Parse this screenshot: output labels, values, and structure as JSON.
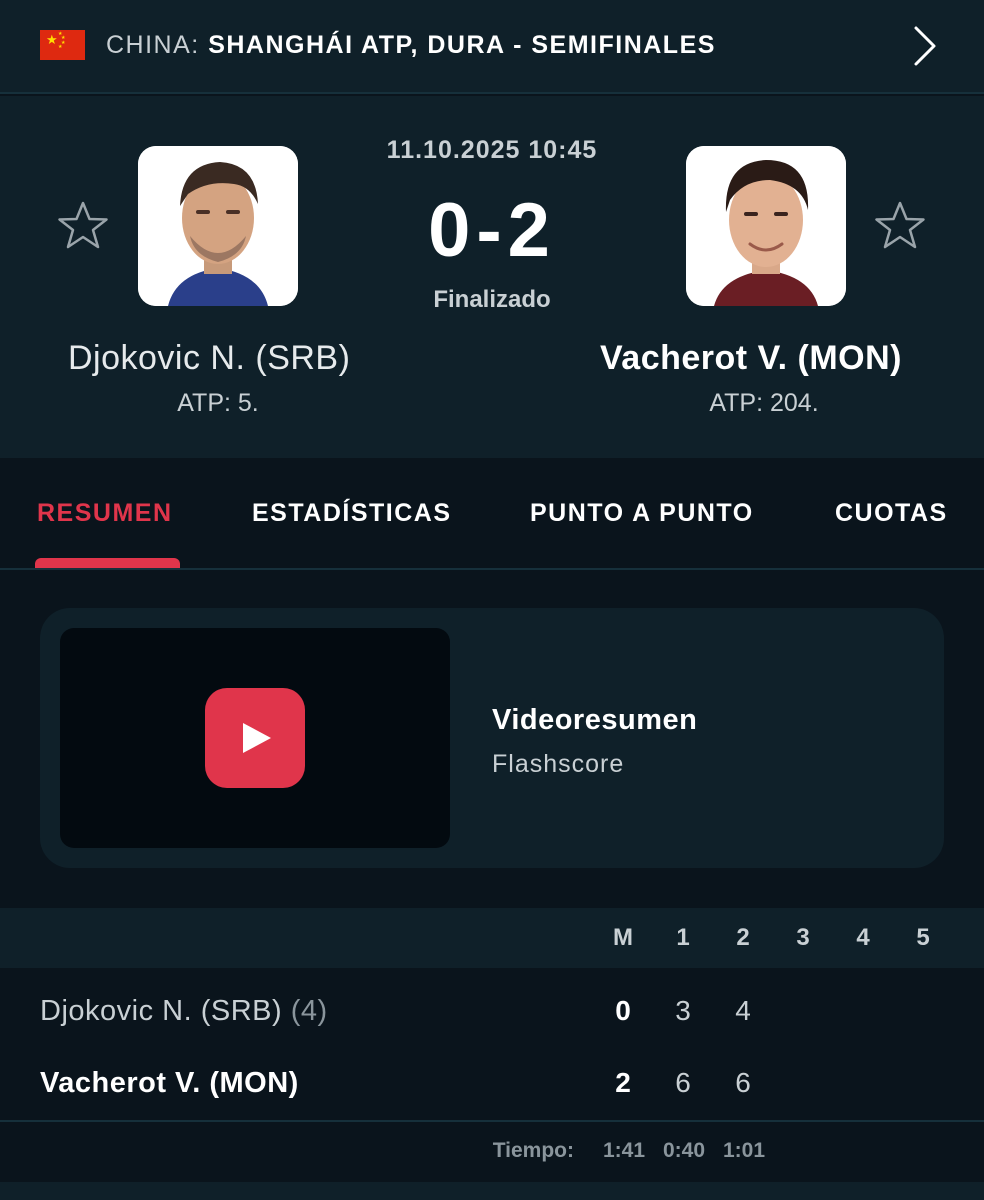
{
  "header": {
    "country": "CHINA: ",
    "tournament": "SHANGHÁI ATP, DURA - SEMIFINALES",
    "flag_icon": "china-flag",
    "colors": {
      "flag_red": "#de2910",
      "flag_yellow": "#ffde00"
    }
  },
  "match": {
    "datetime": "11.10.2025 10:45",
    "score": "0-2",
    "status": "Finalizado",
    "home": {
      "name": "Djokovic N. (SRB)",
      "rank": "ATP: 5."
    },
    "away": {
      "name": "Vacherot V. (MON)",
      "rank": "ATP: 204."
    }
  },
  "tabs": [
    {
      "label": "RESUMEN",
      "active": true
    },
    {
      "label": "ESTADÍSTICAS",
      "active": false
    },
    {
      "label": "PUNTO A PUNTO",
      "active": false
    },
    {
      "label": "CUOTAS",
      "active": false
    }
  ],
  "video": {
    "title": "Videoresumen",
    "source": "Flashscore"
  },
  "scoreboard": {
    "columns": [
      "M",
      "1",
      "2",
      "3",
      "4",
      "5"
    ],
    "rows": [
      {
        "name": "Djokovic N. (SRB)",
        "seed": " (4)",
        "match": "0",
        "sets": [
          "3",
          "4"
        ]
      },
      {
        "name": "Vacherot V. (MON)",
        "seed": "",
        "match": "2",
        "sets": [
          "6",
          "6"
        ]
      }
    ],
    "time_label": "Tiempo:",
    "times": [
      "1:41",
      "0:40",
      "1:01"
    ]
  },
  "colors": {
    "accent": "#e0354b",
    "panel": "#0f2029",
    "background": "#0a141c"
  }
}
